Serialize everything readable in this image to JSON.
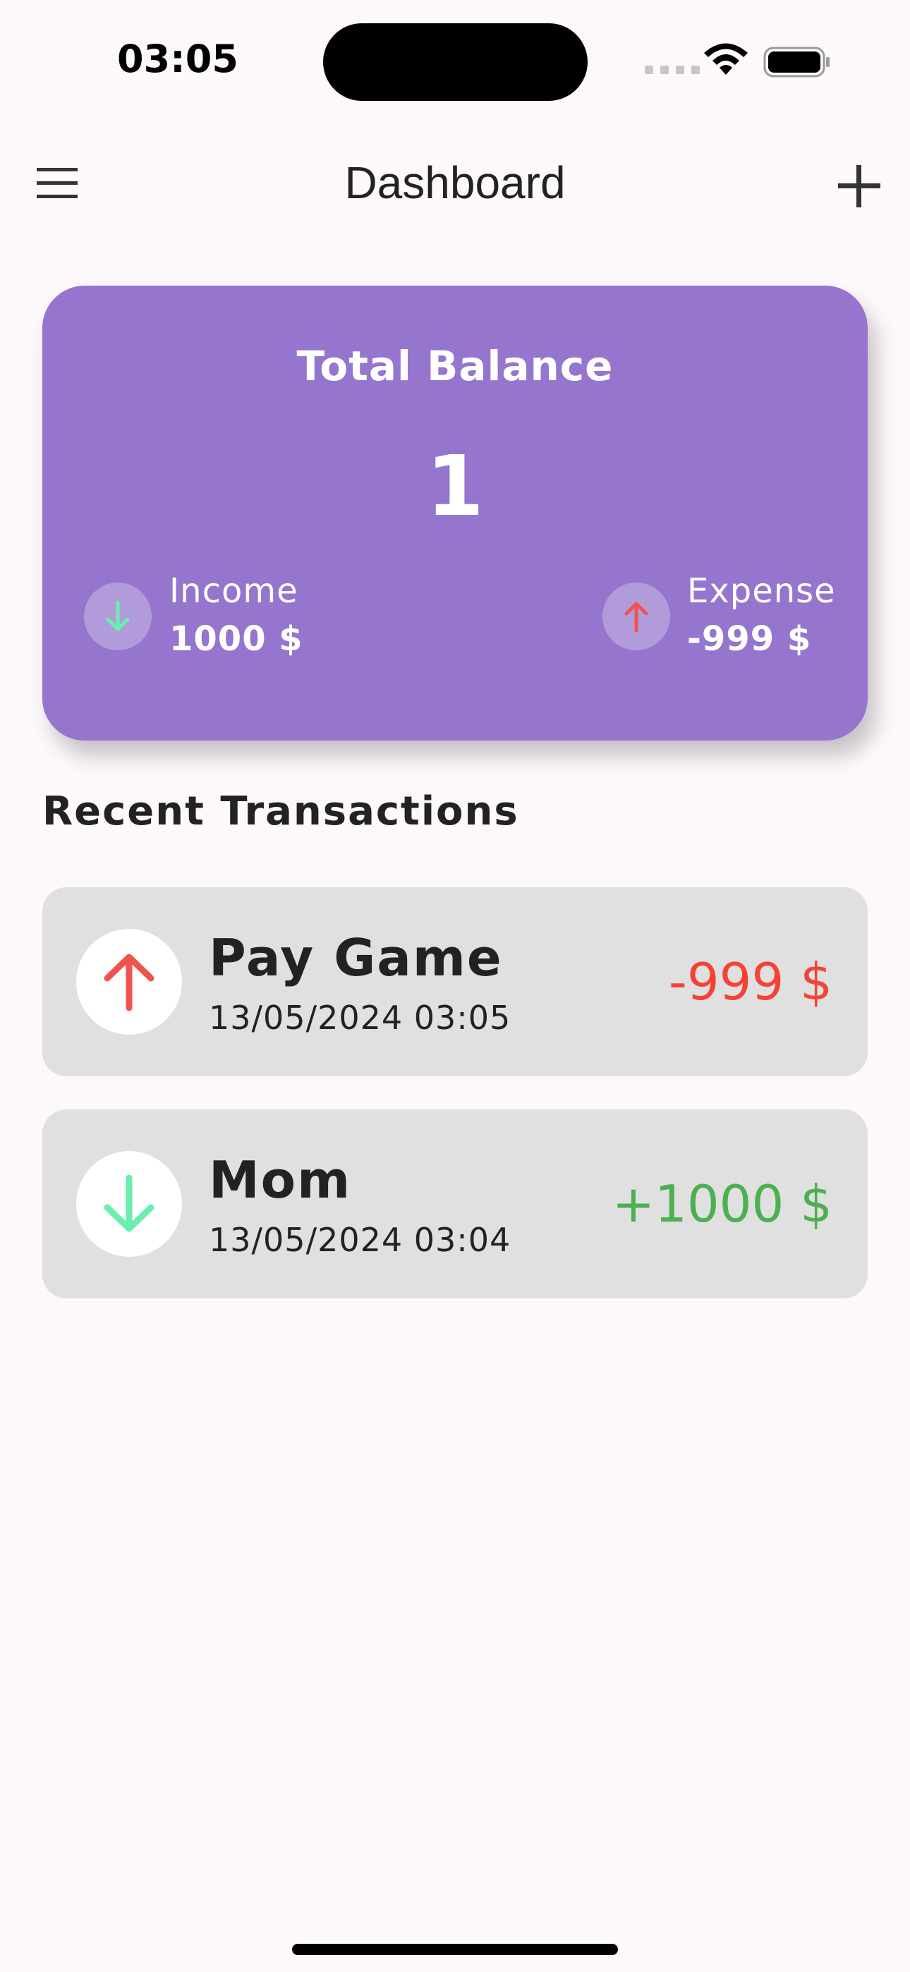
{
  "status_bar": {
    "time": "03:05"
  },
  "app_bar": {
    "title": "Dashboard",
    "menu_icon": "menu-icon",
    "add_icon": "add-icon"
  },
  "balance_card": {
    "title": "Total Balance",
    "amount": "1",
    "background_color": "#9575cd",
    "income": {
      "label": "Income",
      "value": "1000 $",
      "icon": "arrow-down-icon",
      "icon_color": "#69f0ae"
    },
    "expense": {
      "label": "Expense",
      "value": "-999 $",
      "icon": "arrow-up-icon",
      "icon_color": "#ef5350"
    }
  },
  "recent": {
    "title": "Recent Transactions",
    "items": [
      {
        "name": "Pay Game",
        "date": "13/05/2024 03:05",
        "amount": "-999 $",
        "type": "expense",
        "icon": "arrow-up-icon",
        "amount_color": "#f44336",
        "icon_color": "#ef5350"
      },
      {
        "name": "Mom",
        "date": "13/05/2024 03:04",
        "amount": "+1000 $",
        "type": "income",
        "icon": "arrow-down-icon",
        "amount_color": "#4caf50",
        "icon_color": "#69f0ae"
      }
    ]
  }
}
